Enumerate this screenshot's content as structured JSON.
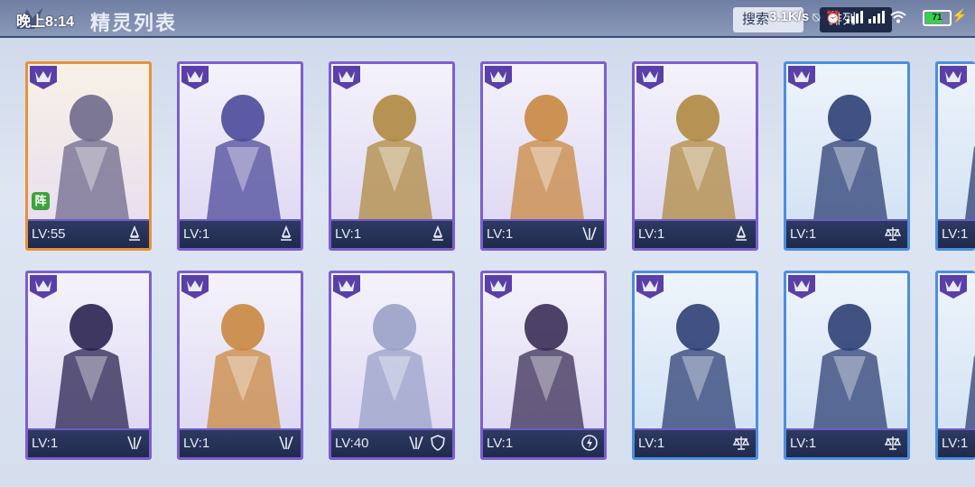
{
  "status_bar": {
    "time": "晚上8:14",
    "net_speed": "3.1K/s",
    "battery": "71"
  },
  "header": {
    "title": "精灵列表",
    "tabs": [
      "搜索",
      "排列"
    ]
  },
  "cards": [
    {
      "level": "LV:55",
      "frame": "gold",
      "formation": "阵",
      "traits": [
        "mage-icon"
      ],
      "theme": "#6f6a8c"
    },
    {
      "level": "LV:1",
      "frame": "purple",
      "traits": [
        "mage-icon"
      ],
      "theme": "#4c4a9a"
    },
    {
      "level": "LV:1",
      "frame": "purple",
      "traits": [
        "mage-icon"
      ],
      "theme": "#b08a40"
    },
    {
      "level": "LV:1",
      "frame": "purple",
      "traits": [
        "demon-icon"
      ],
      "theme": "#c98840"
    },
    {
      "level": "LV:1",
      "frame": "purple",
      "traits": [
        "mage-icon"
      ],
      "theme": "#b08a40"
    },
    {
      "level": "LV:1",
      "frame": "blue",
      "traits": [
        "balance-icon"
      ],
      "theme": "#2d3f74"
    },
    {
      "level": "LV:1",
      "frame": "blue",
      "traits": [],
      "theme": "#2d3f74"
    },
    {
      "level": "LV:1",
      "frame": "purple",
      "traits": [
        "demon-icon"
      ],
      "theme": "#2a2350"
    },
    {
      "level": "LV:1",
      "frame": "purple",
      "traits": [
        "demon-icon"
      ],
      "theme": "#c98840"
    },
    {
      "level": "LV:40",
      "frame": "purple",
      "traits": [
        "demon-icon",
        "shield-icon"
      ],
      "theme": "#9aa2c8"
    },
    {
      "level": "LV:1",
      "frame": "purple",
      "traits": [
        "lightning-icon"
      ],
      "theme": "#3a2f56"
    },
    {
      "level": "LV:1",
      "frame": "blue",
      "traits": [
        "balance-icon"
      ],
      "theme": "#2d3f74"
    },
    {
      "level": "LV:1",
      "frame": "blue",
      "traits": [
        "balance-icon"
      ],
      "theme": "#2d3f74"
    },
    {
      "level": "LV:1",
      "frame": "blue",
      "traits": [],
      "theme": "#2d3f74"
    }
  ]
}
